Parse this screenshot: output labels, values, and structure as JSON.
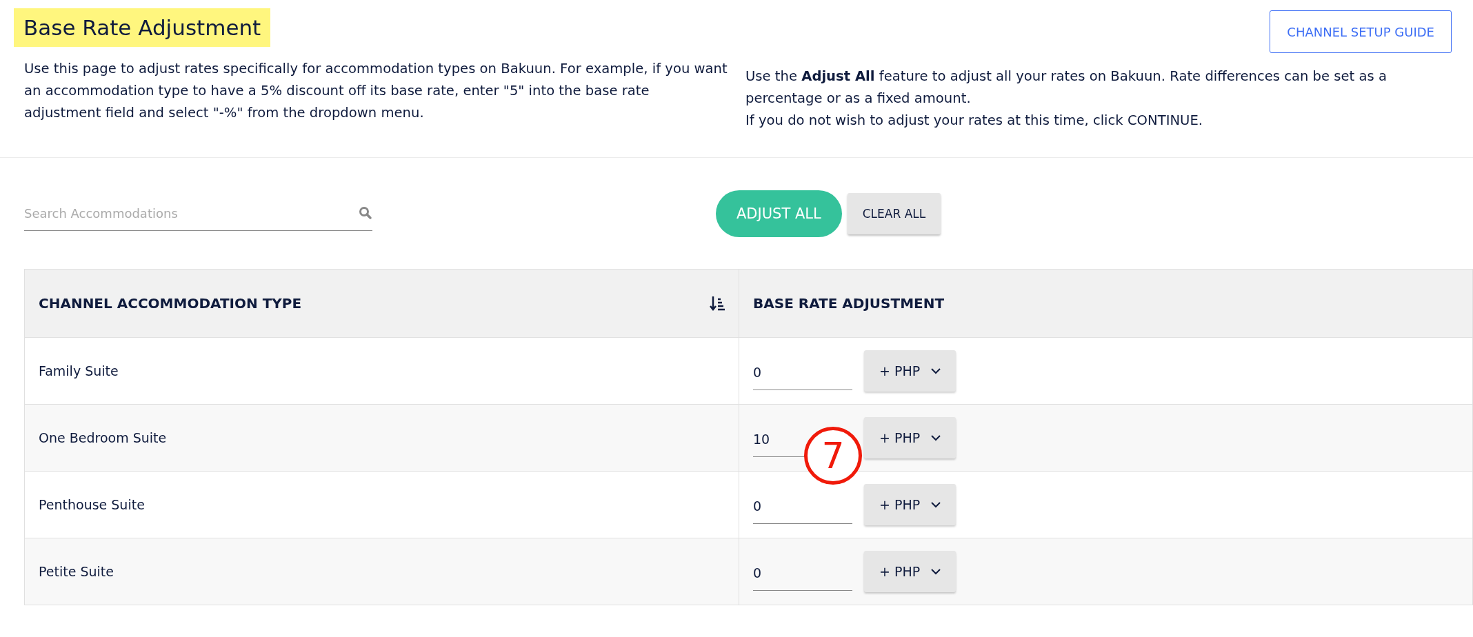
{
  "page": {
    "title": "Base Rate Adjustment",
    "guide_button": "CHANNEL SETUP GUIDE",
    "intro_left": "Use this page to adjust rates specifically for accommodation types on Bakuun. For example, if you want an accommodation type to have a 5% discount off its base rate, enter \"5\" into the base rate adjustment field and select \"-%\" from the dropdown menu.",
    "intro_right": [
      "Use the **Adjust All** feature to adjust all your rates on Bakuun. Rate differences can be set as a percentage or as a fixed amount.",
      "If you do not wish to adjust your rates at this time, click CONTINUE."
    ]
  },
  "search": {
    "placeholder": "Search Accommodations"
  },
  "actions": {
    "adjust_all": "ADJUST ALL",
    "clear_all": "CLEAR ALL"
  },
  "table": {
    "columns": [
      "CHANNEL ACCOMMODATION TYPE",
      "BASE RATE ADJUSTMENT"
    ],
    "rows": [
      {
        "name": "Family Suite",
        "value": "0",
        "unit": "+ PHP"
      },
      {
        "name": "One Bedroom Suite",
        "value": "10",
        "unit": "+ PHP"
      },
      {
        "name": "Penthouse Suite",
        "value": "0",
        "unit": "+ PHP"
      },
      {
        "name": "Petite Suite",
        "value": "0",
        "unit": "+ PHP"
      }
    ]
  },
  "annotation": {
    "label": "7"
  }
}
